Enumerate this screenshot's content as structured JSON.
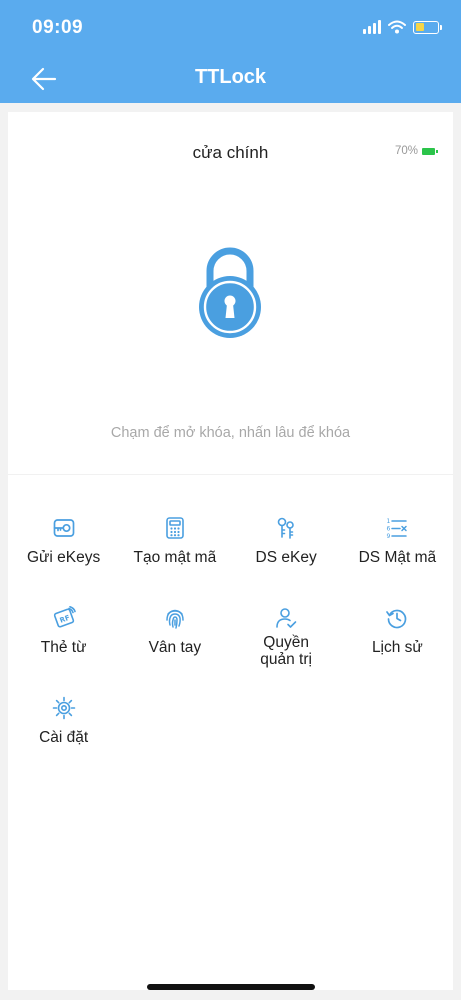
{
  "status_bar": {
    "time": "09:09"
  },
  "nav": {
    "title": "TTLock",
    "back_icon": "arrow-left-icon"
  },
  "lock": {
    "name": "cửa chính",
    "battery_text": "70%",
    "battery_level": 0.7,
    "hint": "Chạm để mở khóa, nhấn lâu để khóa",
    "accent_color": "#4a9fe0"
  },
  "menu": [
    {
      "key": "send-ekeys",
      "label": "Gửi eKeys",
      "icon": "send-ekey-icon"
    },
    {
      "key": "create-passcode",
      "label": "Tạo mật mã",
      "icon": "keypad-icon"
    },
    {
      "key": "ekey-list",
      "label": "DS eKey",
      "icon": "keys-icon"
    },
    {
      "key": "passcode-list",
      "label": "DS Mật mã",
      "icon": "passcode-list-icon"
    },
    {
      "key": "ic-card",
      "label": "Thẻ từ",
      "icon": "rf-card-icon"
    },
    {
      "key": "fingerprint",
      "label": "Vân tay",
      "icon": "fingerprint-icon"
    },
    {
      "key": "admin-rights",
      "label": "Quyền\nquản trị",
      "icon": "user-check-icon"
    },
    {
      "key": "history",
      "label": "Lịch sử",
      "icon": "history-icon"
    },
    {
      "key": "settings",
      "label": "Cài đặt",
      "icon": "gear-icon"
    }
  ]
}
